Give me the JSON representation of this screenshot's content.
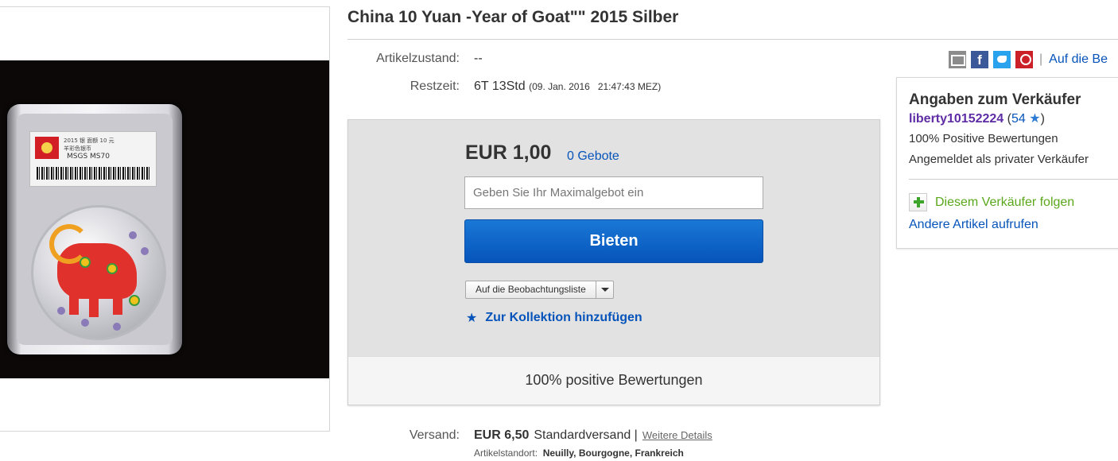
{
  "listing": {
    "title": "China 10 Yuan -Year of Goat\"\" 2015 Silber",
    "image_alt": "Coin in MSGS slab",
    "slab_label": {
      "line1": "2015 银 面额 10 元",
      "line2": "羊彩色银币",
      "grade": "MSGS MS70"
    }
  },
  "details": {
    "condition_label": "Artikelzustand:",
    "condition_value": "--",
    "time_label": "Restzeit:",
    "time_value": "6T 13Std",
    "time_end": "(09. Jan. 2016   21:47:43 MEZ)"
  },
  "share": {
    "icons": [
      "mail-icon",
      "facebook-icon",
      "twitter-icon",
      "pinterest-icon"
    ],
    "separator": "|",
    "watchlist_link": "Auf die Be"
  },
  "bid": {
    "price": "EUR 1,00",
    "bid_count": "0 Gebote",
    "input_placeholder": "Geben Sie Ihr Maximalgebot ein",
    "button_label": "Bieten",
    "watchlist_button": "Auf die Beobachtungsliste",
    "collection_link": "Zur Kollektion hinzufügen",
    "positive_feedback": "100% positive Bewertungen"
  },
  "seller": {
    "heading": "Angaben zum Verkäufer",
    "username": "liberty10152224",
    "score_open": "(",
    "score": "54",
    "score_close": ")",
    "positive": "100% Positive Bewertungen",
    "registered": "Angemeldet als privater Verkäufer",
    "follow": "Diesem Verkäufer folgen",
    "other_items": "Andere Artikel aufrufen"
  },
  "shipping": {
    "label": "Versand:",
    "price": "EUR 6,50",
    "method": "Standardversand |",
    "more_link": "Weitere Details",
    "location_label": "Artikelstandort:",
    "location_value": "Neuilly, Bourgogne, Frankreich"
  },
  "colors": {
    "link_blue": "#0654ba",
    "bid_button": "#0654ba",
    "seller_name": "#5e2ca5",
    "follow_green": "#5ba71b"
  }
}
